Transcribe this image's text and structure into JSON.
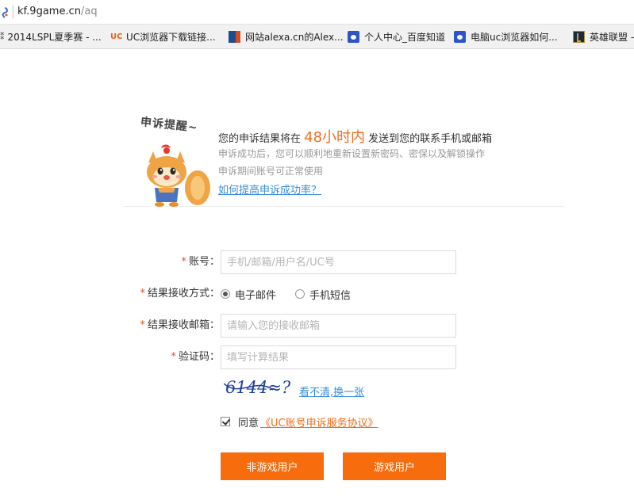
{
  "browser": {
    "url_prefix": "|",
    "url_host": "kf.9game.cn",
    "url_path": "/aq",
    "bookmarks": [
      {
        "label": "2014LSPL夏季赛 - ...",
        "icon": "lol-bookmark-icon"
      },
      {
        "label": "UC浏览器下载链接...",
        "icon": "uc-icon",
        "icon_text": "UC"
      },
      {
        "label": "网站alexa.cn的Alex...",
        "icon": "alexa-icon"
      },
      {
        "label": "个人中心_百度知道",
        "icon": "baidu-paw-icon"
      },
      {
        "label": "电脑uc浏览器如何...",
        "icon": "baidu-paw-icon"
      },
      {
        "label": "英雄联盟 -",
        "icon": "lol-icon"
      }
    ]
  },
  "reminder": {
    "title": "申诉提醒~",
    "notice_before": "您的申诉结果将在 ",
    "notice_highlight": "48小时内",
    "notice_after": " 发送到您的联系手机或邮箱",
    "line1": "申诉成功后，您可以顺利地重新设置新密码、密保以及解锁操作",
    "line2": "申诉期间账号可正常使用",
    "help_link": "如何提高申诉成功率？"
  },
  "form": {
    "required_mark": "*",
    "account_label": "账号：",
    "account_placeholder": "手机/邮箱/用户名/UC号",
    "method_label": "结果接收方式：",
    "method_options": [
      {
        "label": "电子邮件",
        "selected": true
      },
      {
        "label": "手机短信",
        "selected": false
      }
    ],
    "email_label": "结果接收邮箱：",
    "email_placeholder": "请输入您的接收邮箱",
    "captcha_label": "验证码：",
    "captcha_placeholder": "填写计算结果",
    "captcha_text": "6144≈?",
    "refresh_link": "看不清,换一张",
    "agree_text": "同意",
    "agree_link": "《UC账号申诉服务协议》",
    "agree_checked": true,
    "btn_non_game": "非游戏用户",
    "btn_game": "游戏用户"
  },
  "colors": {
    "accent": "#f76c0d",
    "link": "#3a8fd6",
    "required": "#e8511c"
  }
}
